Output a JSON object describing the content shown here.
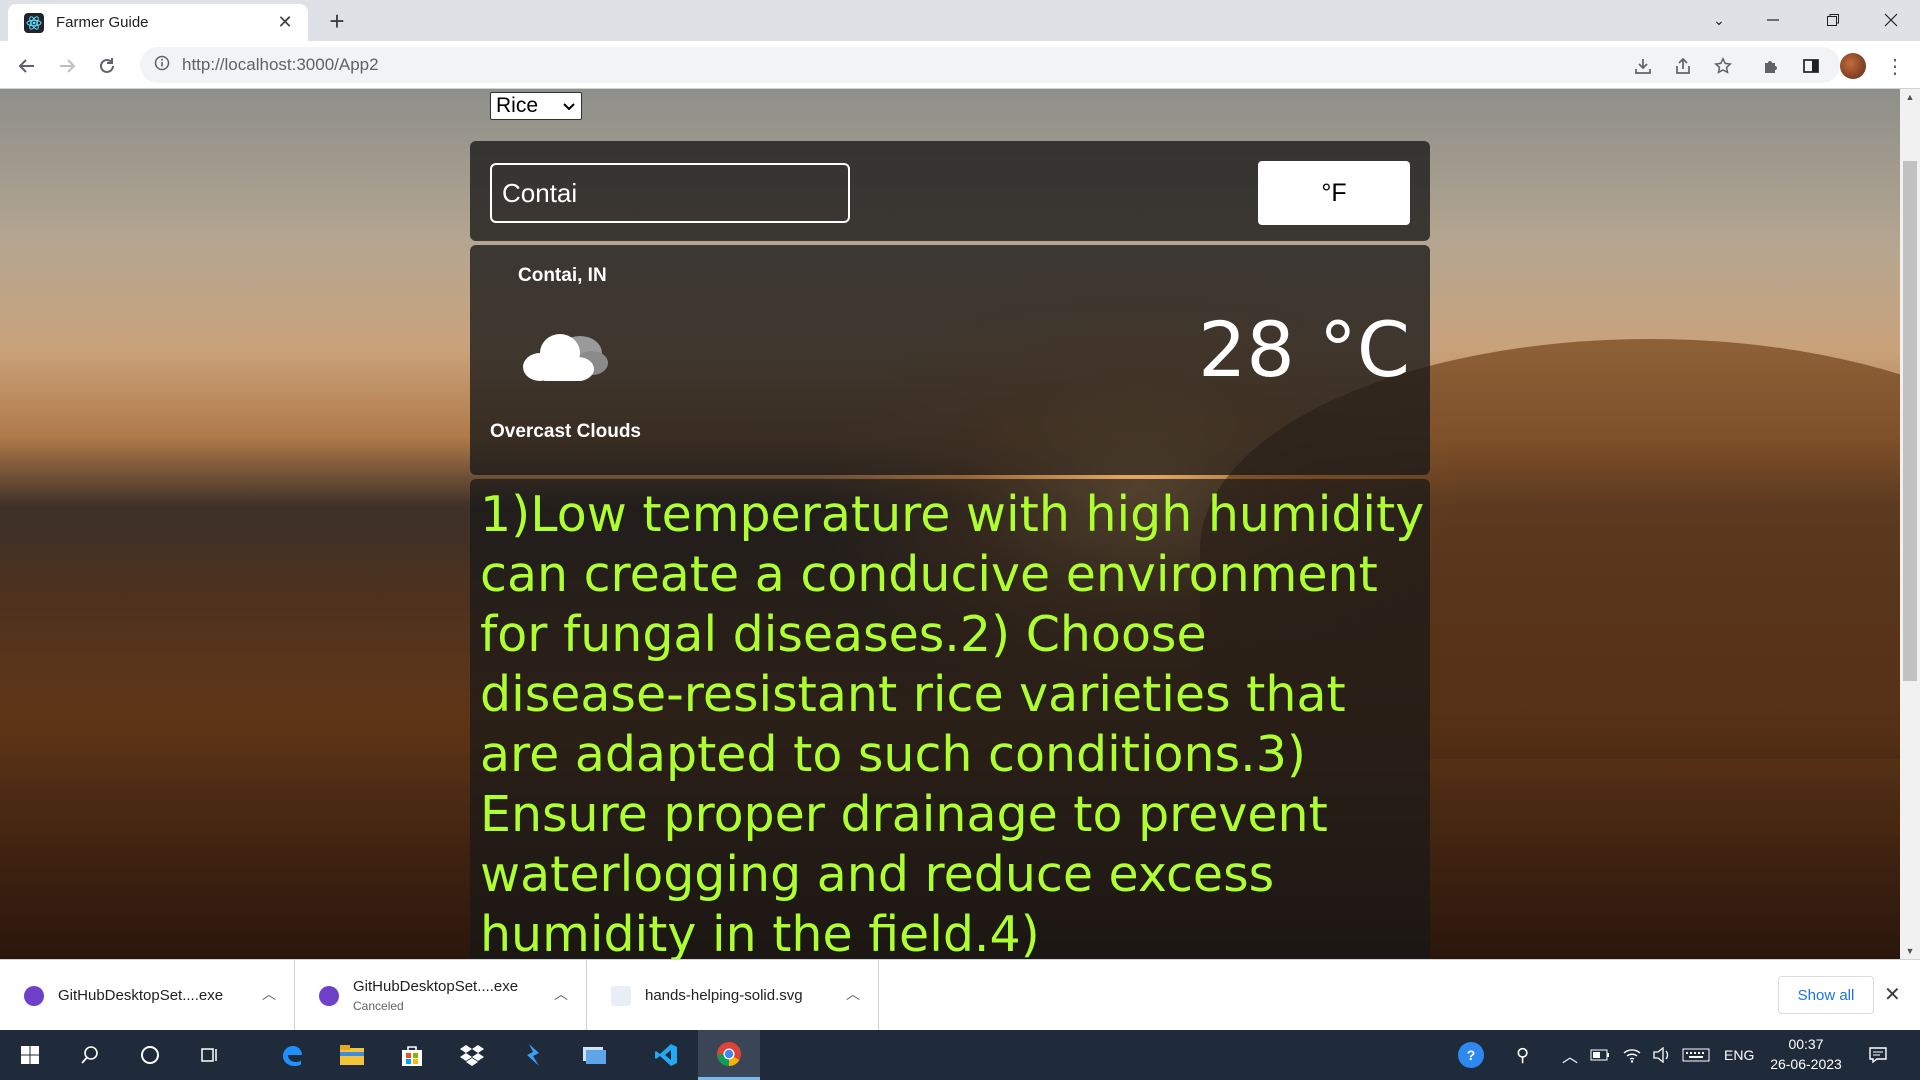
{
  "browser": {
    "tab_title": "Farmer Guide",
    "tab_close": "✕",
    "new_tab": "+",
    "url": "http://localhost:3000/App2"
  },
  "page": {
    "crop_select": {
      "value": "Rice",
      "options": [
        "Rice"
      ]
    },
    "city_input_value": "Contai",
    "unit_toggle_label": "°F",
    "location": "Contai, IN",
    "condition": "Overcast Clouds",
    "temperature": "28 °C",
    "weather_icon": "cloud-icon",
    "tips_text": "1)Low temperature with high humidity can create a conducive environment for fungal diseases.2) Choose disease-resistant rice varieties that are adapted to such conditions.3) Ensure proper drainage to prevent waterlogging and reduce excess humidity in the field.4)",
    "tips_color": "#adff2f"
  },
  "downloads": {
    "items": [
      {
        "name": "GitHubDesktopSet....exe",
        "status": ""
      },
      {
        "name": "GitHubDesktopSet....exe",
        "status": "Canceled"
      },
      {
        "name": "hands-helping-solid.svg",
        "status": ""
      }
    ],
    "show_all": "Show all",
    "close": "✕"
  },
  "taskbar": {
    "language": "ENG",
    "time": "00:37",
    "date": "26-06-2023"
  }
}
